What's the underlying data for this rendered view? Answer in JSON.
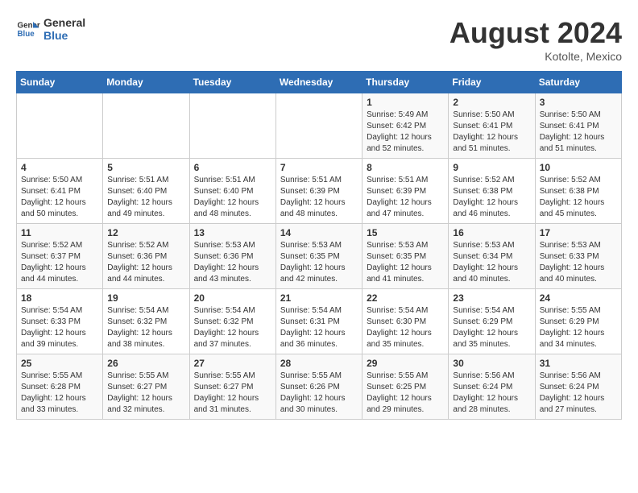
{
  "header": {
    "logo_line1": "General",
    "logo_line2": "Blue",
    "month": "August 2024",
    "location": "Kotolte, Mexico"
  },
  "days_of_week": [
    "Sunday",
    "Monday",
    "Tuesday",
    "Wednesday",
    "Thursday",
    "Friday",
    "Saturday"
  ],
  "weeks": [
    [
      {
        "day": "",
        "info": ""
      },
      {
        "day": "",
        "info": ""
      },
      {
        "day": "",
        "info": ""
      },
      {
        "day": "",
        "info": ""
      },
      {
        "day": "1",
        "info": "Sunrise: 5:49 AM\nSunset: 6:42 PM\nDaylight: 12 hours\nand 52 minutes."
      },
      {
        "day": "2",
        "info": "Sunrise: 5:50 AM\nSunset: 6:41 PM\nDaylight: 12 hours\nand 51 minutes."
      },
      {
        "day": "3",
        "info": "Sunrise: 5:50 AM\nSunset: 6:41 PM\nDaylight: 12 hours\nand 51 minutes."
      }
    ],
    [
      {
        "day": "4",
        "info": "Sunrise: 5:50 AM\nSunset: 6:41 PM\nDaylight: 12 hours\nand 50 minutes."
      },
      {
        "day": "5",
        "info": "Sunrise: 5:51 AM\nSunset: 6:40 PM\nDaylight: 12 hours\nand 49 minutes."
      },
      {
        "day": "6",
        "info": "Sunrise: 5:51 AM\nSunset: 6:40 PM\nDaylight: 12 hours\nand 48 minutes."
      },
      {
        "day": "7",
        "info": "Sunrise: 5:51 AM\nSunset: 6:39 PM\nDaylight: 12 hours\nand 48 minutes."
      },
      {
        "day": "8",
        "info": "Sunrise: 5:51 AM\nSunset: 6:39 PM\nDaylight: 12 hours\nand 47 minutes."
      },
      {
        "day": "9",
        "info": "Sunrise: 5:52 AM\nSunset: 6:38 PM\nDaylight: 12 hours\nand 46 minutes."
      },
      {
        "day": "10",
        "info": "Sunrise: 5:52 AM\nSunset: 6:38 PM\nDaylight: 12 hours\nand 45 minutes."
      }
    ],
    [
      {
        "day": "11",
        "info": "Sunrise: 5:52 AM\nSunset: 6:37 PM\nDaylight: 12 hours\nand 44 minutes."
      },
      {
        "day": "12",
        "info": "Sunrise: 5:52 AM\nSunset: 6:36 PM\nDaylight: 12 hours\nand 44 minutes."
      },
      {
        "day": "13",
        "info": "Sunrise: 5:53 AM\nSunset: 6:36 PM\nDaylight: 12 hours\nand 43 minutes."
      },
      {
        "day": "14",
        "info": "Sunrise: 5:53 AM\nSunset: 6:35 PM\nDaylight: 12 hours\nand 42 minutes."
      },
      {
        "day": "15",
        "info": "Sunrise: 5:53 AM\nSunset: 6:35 PM\nDaylight: 12 hours\nand 41 minutes."
      },
      {
        "day": "16",
        "info": "Sunrise: 5:53 AM\nSunset: 6:34 PM\nDaylight: 12 hours\nand 40 minutes."
      },
      {
        "day": "17",
        "info": "Sunrise: 5:53 AM\nSunset: 6:33 PM\nDaylight: 12 hours\nand 40 minutes."
      }
    ],
    [
      {
        "day": "18",
        "info": "Sunrise: 5:54 AM\nSunset: 6:33 PM\nDaylight: 12 hours\nand 39 minutes."
      },
      {
        "day": "19",
        "info": "Sunrise: 5:54 AM\nSunset: 6:32 PM\nDaylight: 12 hours\nand 38 minutes."
      },
      {
        "day": "20",
        "info": "Sunrise: 5:54 AM\nSunset: 6:32 PM\nDaylight: 12 hours\nand 37 minutes."
      },
      {
        "day": "21",
        "info": "Sunrise: 5:54 AM\nSunset: 6:31 PM\nDaylight: 12 hours\nand 36 minutes."
      },
      {
        "day": "22",
        "info": "Sunrise: 5:54 AM\nSunset: 6:30 PM\nDaylight: 12 hours\nand 35 minutes."
      },
      {
        "day": "23",
        "info": "Sunrise: 5:54 AM\nSunset: 6:29 PM\nDaylight: 12 hours\nand 35 minutes."
      },
      {
        "day": "24",
        "info": "Sunrise: 5:55 AM\nSunset: 6:29 PM\nDaylight: 12 hours\nand 34 minutes."
      }
    ],
    [
      {
        "day": "25",
        "info": "Sunrise: 5:55 AM\nSunset: 6:28 PM\nDaylight: 12 hours\nand 33 minutes."
      },
      {
        "day": "26",
        "info": "Sunrise: 5:55 AM\nSunset: 6:27 PM\nDaylight: 12 hours\nand 32 minutes."
      },
      {
        "day": "27",
        "info": "Sunrise: 5:55 AM\nSunset: 6:27 PM\nDaylight: 12 hours\nand 31 minutes."
      },
      {
        "day": "28",
        "info": "Sunrise: 5:55 AM\nSunset: 6:26 PM\nDaylight: 12 hours\nand 30 minutes."
      },
      {
        "day": "29",
        "info": "Sunrise: 5:55 AM\nSunset: 6:25 PM\nDaylight: 12 hours\nand 29 minutes."
      },
      {
        "day": "30",
        "info": "Sunrise: 5:56 AM\nSunset: 6:24 PM\nDaylight: 12 hours\nand 28 minutes."
      },
      {
        "day": "31",
        "info": "Sunrise: 5:56 AM\nSunset: 6:24 PM\nDaylight: 12 hours\nand 27 minutes."
      }
    ]
  ]
}
